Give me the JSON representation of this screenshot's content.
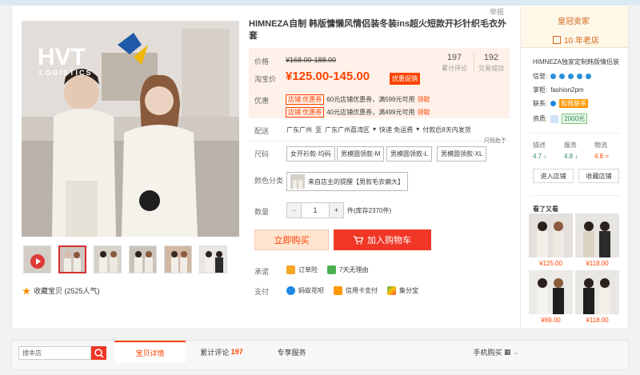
{
  "report_label": "举报",
  "title": "HIMNEZA自制 韩版慵懒风情侣装冬装ins超火短款开衫针织毛衣外套",
  "watermark": {
    "brand": "HVT",
    "sub": "LOGISTICS"
  },
  "price": {
    "orig_label": "价格",
    "orig_value": "¥168.00-188.00",
    "now_label": "淘宝价",
    "now_value": "¥125.00-145.00",
    "promo_badge": "优惠促销",
    "reviews_num": "197",
    "reviews_label": "累计评论",
    "sales_num": "192",
    "sales_label": "交易成功",
    "coupon_label": "优惠",
    "coupons": [
      {
        "tag": "店铺:优惠券",
        "text": "60元店铺优惠券，满599元可用",
        "link": "领取"
      },
      {
        "tag": "店铺:优惠券",
        "text": "40元店铺优惠券，满499元可用",
        "link": "领取"
      }
    ]
  },
  "delivery": {
    "label": "配送",
    "from": "广东广州",
    "to_word": "至",
    "to": "广东广州荔湾区",
    "ship": "快递 免运费",
    "pay": "付款后8天内发货"
  },
  "size": {
    "label": "尺码",
    "helper": "尺码助手",
    "options": [
      "女开衫款-均码",
      "男模圆领款-M",
      "男模圆领款-L",
      "男模圆领款-XL"
    ]
  },
  "color": {
    "label": "颜色分类",
    "option": "来自店主的提醒【男款毛衣偏大】"
  },
  "qty": {
    "label": "数量",
    "minus": "−",
    "value": "1",
    "plus": "+",
    "stock": "件(库存2370件)"
  },
  "buttons": {
    "buy": "立即购买",
    "cart": "加入购物车"
  },
  "promise": {
    "label": "承诺",
    "items": [
      "订单险",
      "7天无理由"
    ]
  },
  "payment": {
    "label": "支付",
    "items": [
      "蚂蚁花呗",
      "信用卡支付",
      "集分宝"
    ]
  },
  "favorite": "收藏宝贝 (2525人气)",
  "shop": {
    "badge": "皇冠卖家",
    "years": "10 年老店",
    "name": "HIMNEZA独家定制韩版情侣装",
    "credit_label": "信誉:",
    "wangwang_label": "掌柜:",
    "wangwang": "fashion2pm",
    "contact_label": "联系:",
    "contact": "和我联系",
    "quali_label": "资质:",
    "quali": "2000元",
    "ratings": [
      {
        "label": "描述",
        "value": "4.7",
        "dir": "↓"
      },
      {
        "label": "服务",
        "value": "4.8",
        "dir": "↓"
      },
      {
        "label": "物流",
        "value": "4.8",
        "dir": "="
      }
    ],
    "enter": "进入店铺",
    "collect": "收藏店铺",
    "see_also": "看了又看",
    "recs": [
      {
        "price": "¥125.00"
      },
      {
        "price": "¥118.00"
      },
      {
        "price": "¥69.00"
      },
      {
        "price": "¥118.00"
      }
    ]
  },
  "bottom": {
    "search_placeholder": "搜本店",
    "tabs": [
      "宝贝详情",
      "累计评论",
      "专享服务",
      "手机购买"
    ],
    "review_count": "197"
  },
  "colors": {
    "accent": "#ff4400",
    "cart": "#f03726",
    "buy_bg": "#ffe4d0"
  }
}
